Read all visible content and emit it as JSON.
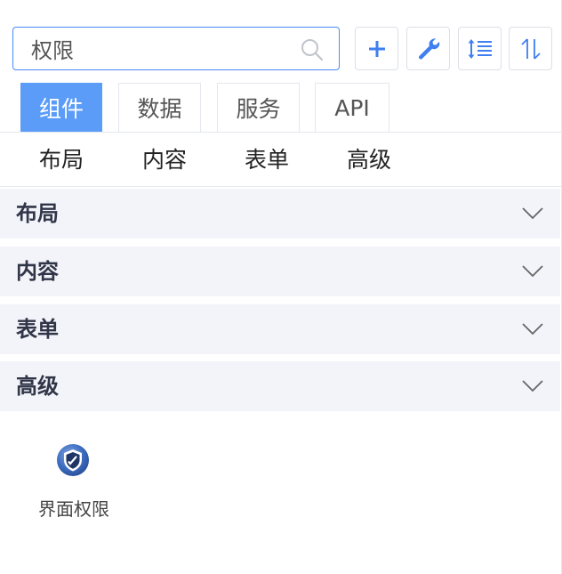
{
  "search": {
    "value": "权限"
  },
  "toolbar": {
    "add_icon": "plus-icon",
    "settings_icon": "wrench-icon",
    "sort_icon": "sort-lines-icon",
    "swap_icon": "up-down-arrows-icon"
  },
  "tabs": [
    {
      "label": "组件",
      "active": true
    },
    {
      "label": "数据",
      "active": false
    },
    {
      "label": "服务",
      "active": false
    },
    {
      "label": "API",
      "active": false
    }
  ],
  "subtabs": [
    {
      "label": "布局"
    },
    {
      "label": "内容"
    },
    {
      "label": "表单"
    },
    {
      "label": "高级"
    }
  ],
  "sections": [
    {
      "title": "布局",
      "expanded": false
    },
    {
      "title": "内容",
      "expanded": false
    },
    {
      "title": "表单",
      "expanded": false
    },
    {
      "title": "高级",
      "expanded": true
    }
  ],
  "components": [
    {
      "label": "界面权限",
      "icon": "shield-icon"
    }
  ],
  "colors": {
    "accent": "#4a8af4",
    "active_tab": "#5a9cf8",
    "section_bg": "#f2f4f9",
    "section_text": "#303548",
    "border": "#dcdfe6"
  }
}
